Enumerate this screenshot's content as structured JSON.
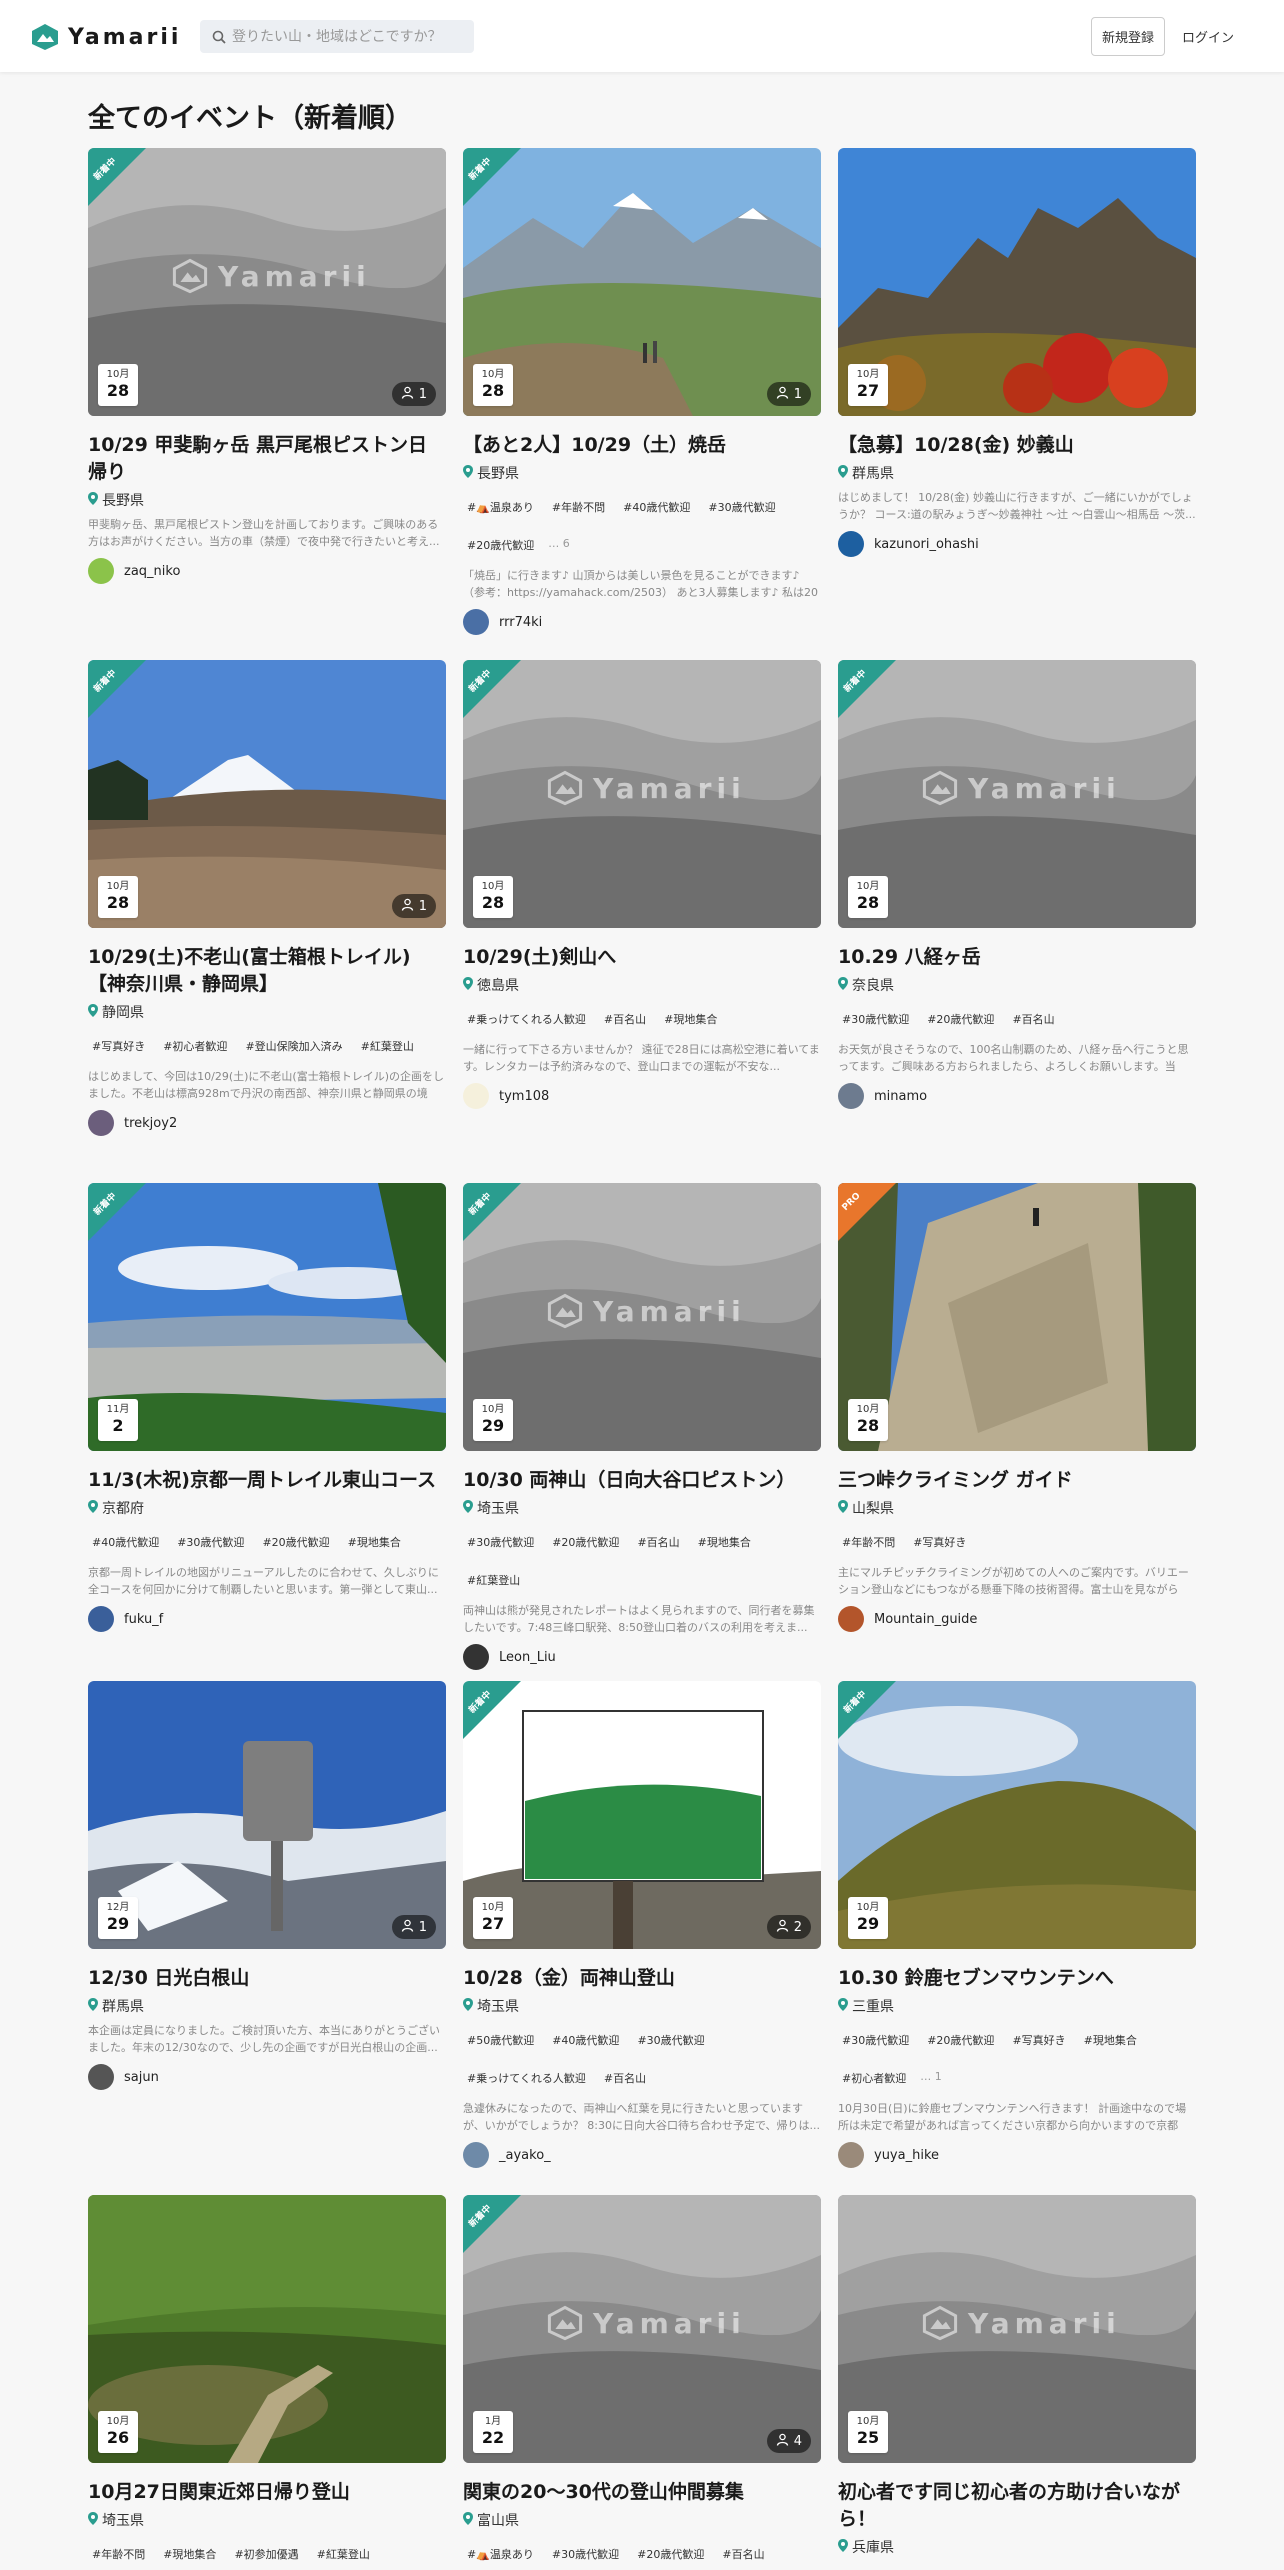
{
  "header": {
    "brand": "Yamarii",
    "search_placeholder": "登りたい山・地域はどこですか？",
    "signup": "新規登録",
    "login": "ログイン"
  },
  "page_title": "全てのイベント（新着順）",
  "watermark": "Yamarii",
  "colors": {
    "brand": "#2a9d8f",
    "pro": "#e8762c"
  },
  "cards": [
    {
      "ribbon": "新着中",
      "month": "10月",
      "day": "28",
      "members": "1",
      "title": "10/29 甲斐駒ヶ岳 黒戸尾根ピストン日帰り",
      "pref": "長野県",
      "tags": [],
      "desc": "甲斐駒ヶ岳、黒戸尾根ピストン登山を計画しております。ご興味のある方はお声がけください。当方の車（禁煙）で夜中発で行きたいと考え...",
      "user": "zaq_niko"
    },
    {
      "ribbon": "新着中",
      "month": "10月",
      "day": "28",
      "members": "1",
      "title": "【あと2人】10/29（土）焼岳",
      "pref": "長野県",
      "tags": [
        "#⛺温泉あり",
        "#年齢不問",
        "#40歳代歓迎",
        "#30歳代歓迎",
        "#20歳代歓迎"
      ],
      "more": "… 6",
      "desc": "「焼岳」に行きます♪ 山頂からは美しい景色を見ることができます♪（参考：https://yamahack.com/2503） あと3人募集します♪ 私は20代...",
      "user": "rrr74ki"
    },
    {
      "ribbon": "",
      "month": "10月",
      "day": "27",
      "members": "",
      "title": "【急募】10/28(金) 妙義山",
      "pref": "群馬県",
      "tags": [],
      "desc": "はじめまして！ 10/28(金) 妙義山に行きますが、ご一緒にいかがでしょうか？ コース:道の駅みょうぎ〜妙義神社 〜辻 〜白雲山〜相馬岳 〜茨...",
      "user": "kazunori_ohashi"
    },
    {
      "ribbon": "新着中",
      "month": "10月",
      "day": "28",
      "members": "1",
      "title": "10/29(土)不老山(富士箱根トレイル)【神奈川県・静岡県】",
      "pref": "静岡県",
      "tags": [
        "#写真好き",
        "#初心者歓迎",
        "#登山保険加入済み",
        "#紅葉登山"
      ],
      "desc": "はじめまして、今回は10/29(土)に不老山(富士箱根トレイル)の企画をしました。不老山は標高928mで丹沢の南西部、神奈川県と静岡県の境に...",
      "user": "trekjoy2"
    },
    {
      "ribbon": "新着中",
      "month": "10月",
      "day": "28",
      "members": "",
      "title": "10/29(土)剣山へ",
      "pref": "徳島県",
      "tags": [
        "#乗っけてくれる人歓迎",
        "#百名山",
        "#現地集合"
      ],
      "desc": "一緒に行って下さる方いませんか？ 遠征で28日には高松空港に着いてます。レンタカーは予約済みなので、登山口までの運転が不安な...",
      "user": "tym108"
    },
    {
      "ribbon": "新着中",
      "month": "10月",
      "day": "28",
      "members": "",
      "title": "10.29 八経ヶ岳",
      "pref": "奈良県",
      "tags": [
        "#30歳代歓迎",
        "#20歳代歓迎",
        "#百名山"
      ],
      "desc": "お天気が良さそうなので、100名山制覇のため、八経ヶ岳へ行こうと思ってます。ご興味ある方おられましたら、よろしくお願いします。当方...",
      "user": "minamo"
    },
    {
      "ribbon": "新着中",
      "month": "11月",
      "day": "2",
      "members": "",
      "title": "11/3(木祝)京都一周トレイル東山コース",
      "pref": "京都府",
      "tags": [
        "#40歳代歓迎",
        "#30歳代歓迎",
        "#20歳代歓迎",
        "#現地集合"
      ],
      "desc": "京都一周トレイルの地図がリニューアルしたのに合わせて、久しぶりに全コースを何回かに分けて制覇したいと思います。第一弾として東山...",
      "user": "fuku_f"
    },
    {
      "ribbon": "新着中",
      "month": "10月",
      "day": "29",
      "members": "",
      "title": "10/30 両神山（日向大谷口ピストン）",
      "pref": "埼玉県",
      "tags": [
        "#30歳代歓迎",
        "#20歳代歓迎",
        "#百名山",
        "#現地集合",
        "#紅葉登山"
      ],
      "desc": "両神山は熊が発見されたレポートはよく見られますので、同行者を募集したいです。7:48三峰口駅発、8:50登山口着のバスの利用を考えま...",
      "user": "Leon_Liu"
    },
    {
      "ribbon": "PRO",
      "month": "10月",
      "day": "28",
      "members": "",
      "title": "三つ峠クライミング ガイド",
      "pref": "山梨県",
      "tags": [
        "#年齢不問",
        "#写真好き"
      ],
      "desc": "主にマルチピッチクライミングが初めての人へのご案内です。バリエーション登山などにもつながる懸垂下降の技術習得。富士山を見ながら爽...",
      "user": "Mountain_guide"
    },
    {
      "ribbon": "",
      "month": "12月",
      "day": "29",
      "members": "1",
      "title": "12/30 日光白根山",
      "pref": "群馬県",
      "tags": [],
      "desc": "本企画は定員になりました。ご検討頂いた方、本当にありがとうございました。年末の12/30なので、少し先の企画ですが日光白根山の企画...",
      "user": "sajun"
    },
    {
      "ribbon": "新着中",
      "month": "10月",
      "day": "27",
      "members": "2",
      "title": "10/28（金）両神山登山",
      "pref": "埼玉県",
      "tags": [
        "#50歳代歓迎",
        "#40歳代歓迎",
        "#30歳代歓迎",
        "#乗っけてくれる人歓迎",
        "#百名山"
      ],
      "desc": "急遽休みになったので、両神山へ紅葉を見に行きたいと思っていますが、いかがでしょうか？ 8:30に日向大谷口待ち合わせ予定で、帰りは...",
      "user": "_ayako_"
    },
    {
      "ribbon": "新着中",
      "month": "10月",
      "day": "29",
      "members": "",
      "title": "10.30 鈴鹿セブンマウンテンへ",
      "pref": "三重県",
      "tags": [
        "#30歳代歓迎",
        "#20歳代歓迎",
        "#写真好き",
        "#現地集合",
        "#初心者歓迎"
      ],
      "more": "… 1",
      "desc": "10月30日(日)に鈴鹿セブンマウンテンへ行きます！ 計画途中なので場所は未定で希望があれば言ってください京都から向かいますので京都付...",
      "user": "yuya_hike"
    },
    {
      "ribbon": "",
      "month": "10月",
      "day": "26",
      "members": "",
      "title": "10月27日関東近郊日帰り登山",
      "pref": "埼玉県",
      "tags": [
        "#年齢不問",
        "#現地集合",
        "#初参加優遇",
        "#紅葉登山"
      ],
      "desc": "",
      "user": ""
    },
    {
      "ribbon": "新着中",
      "month": "1月",
      "day": "22",
      "members": "4",
      "title": "関東の20〜30代の登山仲間募集",
      "pref": "富山県",
      "tags": [
        "#⛺温泉あり",
        "#30歳代歓迎",
        "#20歳代歓迎",
        "#百名山"
      ],
      "desc": "",
      "user": ""
    },
    {
      "ribbon": "",
      "month": "10月",
      "day": "25",
      "members": "",
      "title": "初心者です同じ初心者の方助け合いながら！",
      "pref": "兵庫県",
      "tags": [],
      "desc": "",
      "user": ""
    }
  ]
}
